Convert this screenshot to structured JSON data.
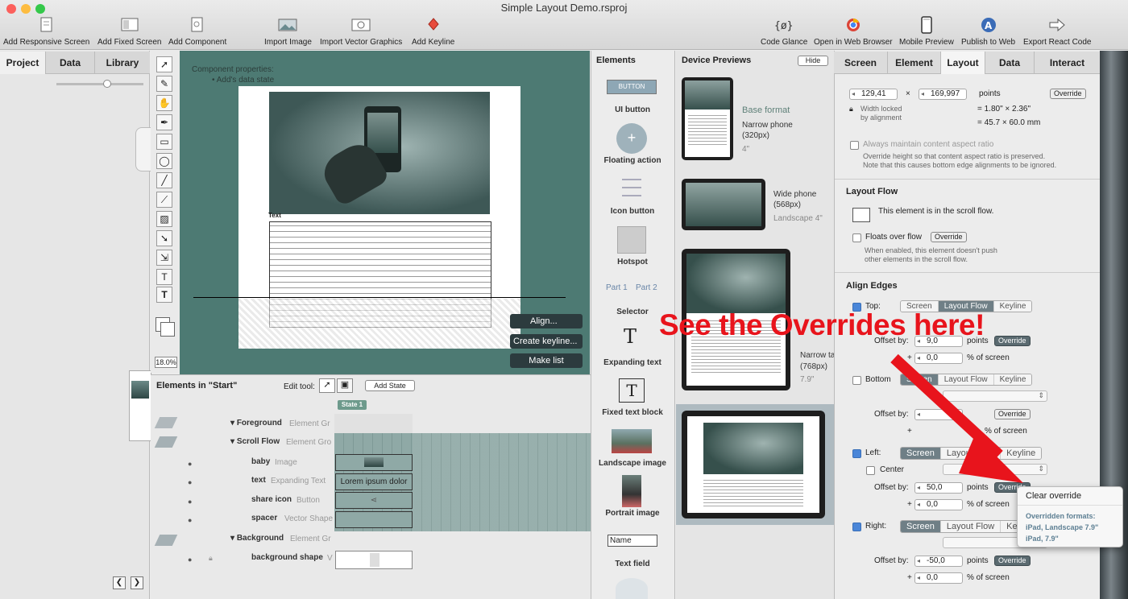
{
  "window": {
    "title": "Simple Layout Demo.rsproj"
  },
  "toolbar": {
    "left": [
      {
        "label": "Add Responsive Screen",
        "icon": "document-icon"
      },
      {
        "label": "Add Fixed Screen",
        "icon": "fixed-screen-icon"
      },
      {
        "label": "Add Component",
        "icon": "component-icon"
      },
      {
        "label": "Import Image",
        "icon": "image-icon"
      },
      {
        "label": "Import Vector Graphics",
        "icon": "vector-icon"
      },
      {
        "label": "Add Keyline",
        "icon": "keyline-icon"
      }
    ],
    "right": [
      {
        "label": "Code Glance",
        "icon": "code-glance-icon"
      },
      {
        "label": "Open in Web Browser",
        "icon": "browser-icon"
      },
      {
        "label": "Mobile Preview",
        "icon": "phone-icon"
      },
      {
        "label": "Publish to Web",
        "icon": "publish-icon"
      },
      {
        "label": "Export React Code",
        "icon": "export-icon"
      }
    ]
  },
  "left_tabs": [
    "Project",
    "Data",
    "Library"
  ],
  "canvas": {
    "header_text": "Component properties:",
    "header_sub": "• Add's data state",
    "text_label": "Text",
    "zoom": "18.0%",
    "buttons": {
      "align": "Align...",
      "keyline": "Create keyline...",
      "make_list": "Make list"
    }
  },
  "elements_panel": {
    "title": "Elements in \"Start\"",
    "edit_tool": "Edit tool:",
    "add_state": "Add State",
    "state": "State 1",
    "rows": [
      {
        "name": "Foreground",
        "type": "Element Gr",
        "level": 0
      },
      {
        "name": "Scroll Flow",
        "type": "Element Gro",
        "level": 0
      },
      {
        "name": "baby",
        "type": "Image",
        "level": 1
      },
      {
        "name": "text",
        "type": "Expanding Text",
        "level": 1
      },
      {
        "name": "share icon",
        "type": "Button",
        "level": 1
      },
      {
        "name": "spacer",
        "type": "Vector Shape",
        "level": 1
      },
      {
        "name": "Background",
        "type": "Element Gr",
        "level": 0
      },
      {
        "name": "background shape",
        "type": "V",
        "level": 1
      }
    ],
    "cell_text": "Lorem ipsum dolor"
  },
  "palette": {
    "title": "Elements",
    "button_text": "BUTTON",
    "part1": "Part 1",
    "part2": "Part 2",
    "name_field": "Name",
    "items": [
      "UI button",
      "Floating action",
      "Icon button",
      "Hotspot",
      "Selector",
      "Expanding text",
      "Fixed text block",
      "Landscape image",
      "Portrait image",
      "Text field"
    ]
  },
  "previews": {
    "title": "Device Previews",
    "hide": "Hide",
    "items": [
      {
        "name": "Base format",
        "desc": "Narrow phone",
        "size": "(320px)",
        "extra": "4\""
      },
      {
        "name": "Wide phone",
        "size": "(568px)",
        "extra": "Landscape 4\""
      },
      {
        "name": "Narrow ta",
        "size": "(768px)",
        "extra": "7.9\""
      }
    ]
  },
  "right_tabs": [
    "Screen",
    "Element",
    "Layout",
    "Data",
    "Interact"
  ],
  "layout": {
    "width": "129,41",
    "height": "169,997",
    "units": "points",
    "override": "Override",
    "lock_note": "Width locked by alignment",
    "inches": "= 1.80\" × 2.36\"",
    "mm": "= 45.7 × 60.0 mm",
    "aspect_label": "Always maintain content aspect ratio",
    "aspect_note1": "Override height so that content aspect ratio is preserved.",
    "aspect_note2": "Note that this causes bottom edge alignments to be ignored.",
    "flow_title": "Layout Flow",
    "flow_note": "This element is in the scroll flow.",
    "floats_label": "Floats over flow",
    "floats_note1": "When enabled, this element doesn't push",
    "floats_note2": "other elements in the scroll flow.",
    "align_title": "Align Edges",
    "seg": [
      "Screen",
      "Layout Flow",
      "Keyline"
    ],
    "top_label": "Top:",
    "bottom_label": "Bottom",
    "left_label": "Left:",
    "right_label": "Right:",
    "center_label": "Center",
    "offset_label": "Offset by:",
    "pct": "% of screen",
    "top_offset": "9,0",
    "top_pct": "0,0",
    "left_offset": "50,0",
    "left_pct": "0,0",
    "right_offset": "-50,0",
    "right_pct": "0,0",
    "points": "points"
  },
  "popup": {
    "clear": "Clear override",
    "title": "Overridden formats:",
    "line1": "iPad, Landscape 7.9\"",
    "line2": "iPad, 7.9\""
  },
  "annotation": {
    "text": "See the Overrides here!",
    "color": "#e8141c"
  },
  "colors": {
    "canvas_bg": "#4d7a73",
    "accent": "#4a86d8",
    "teal_cell": "#8fa9a6"
  }
}
